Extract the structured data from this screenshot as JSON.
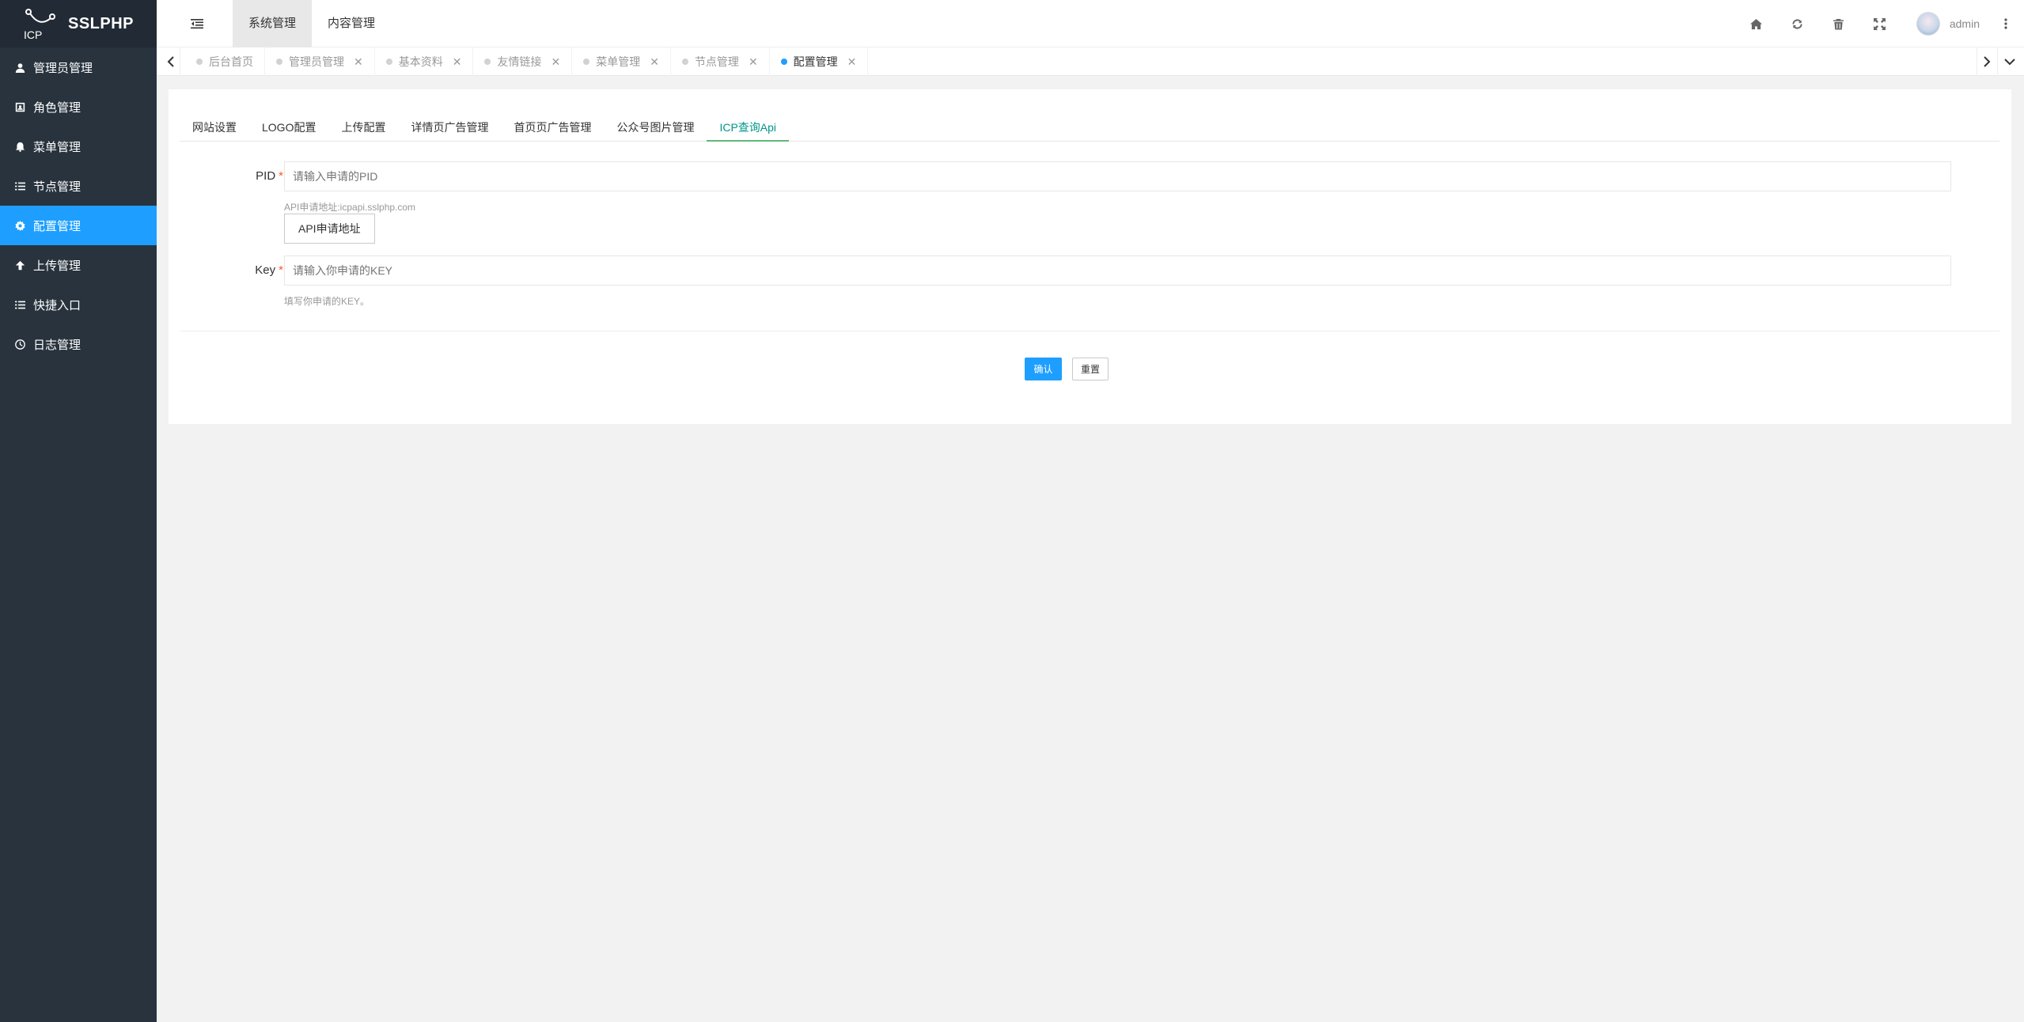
{
  "app": {
    "logo_mark": "ICP",
    "logo_text": "SSLPHP"
  },
  "sidebar": {
    "items": [
      {
        "label": "管理员管理",
        "icon": "user-icon"
      },
      {
        "label": "角色管理",
        "icon": "id-card-icon"
      },
      {
        "label": "菜单管理",
        "icon": "bell-icon"
      },
      {
        "label": "节点管理",
        "icon": "list-icon"
      },
      {
        "label": "配置管理",
        "icon": "gear-icon",
        "active": true
      },
      {
        "label": "上传管理",
        "icon": "arrow-up-icon"
      },
      {
        "label": "快捷入口",
        "icon": "list-icon"
      },
      {
        "label": "日志管理",
        "icon": "clock-icon"
      }
    ]
  },
  "header": {
    "nav": [
      {
        "label": "系统管理",
        "active": true
      },
      {
        "label": "内容管理"
      }
    ],
    "icons": [
      "home-icon",
      "refresh-icon",
      "trash-icon",
      "fullscreen-icon"
    ],
    "username": "admin"
  },
  "tabs": [
    {
      "label": "后台首页",
      "closable": false
    },
    {
      "label": "管理员管理",
      "closable": true
    },
    {
      "label": "基本资料",
      "closable": true
    },
    {
      "label": "友情链接",
      "closable": true
    },
    {
      "label": "菜单管理",
      "closable": true
    },
    {
      "label": "节点管理",
      "closable": true
    },
    {
      "label": "配置管理",
      "closable": true,
      "active": true
    }
  ],
  "sub_tabs": [
    {
      "label": "网站设置"
    },
    {
      "label": "LOGO配置"
    },
    {
      "label": "上传配置"
    },
    {
      "label": "详情页广告管理"
    },
    {
      "label": "首页页广告管理"
    },
    {
      "label": "公众号图片管理"
    },
    {
      "label": "ICP查询Api",
      "active": true
    }
  ],
  "form": {
    "pid": {
      "label": "PID",
      "placeholder": "请输入申请的PID",
      "help": "API申请地址:icpapi.sslphp.com",
      "button": "API申请地址"
    },
    "key": {
      "label": "Key",
      "placeholder": "请输入你申请的KEY",
      "help": "填写你申请的KEY。"
    },
    "required_mark": "*",
    "submit": "确认",
    "reset": "重置"
  },
  "colors": {
    "sidebar_bg": "#28333e",
    "active_blue": "#1e9fff",
    "tab_active_green": "#009688"
  }
}
